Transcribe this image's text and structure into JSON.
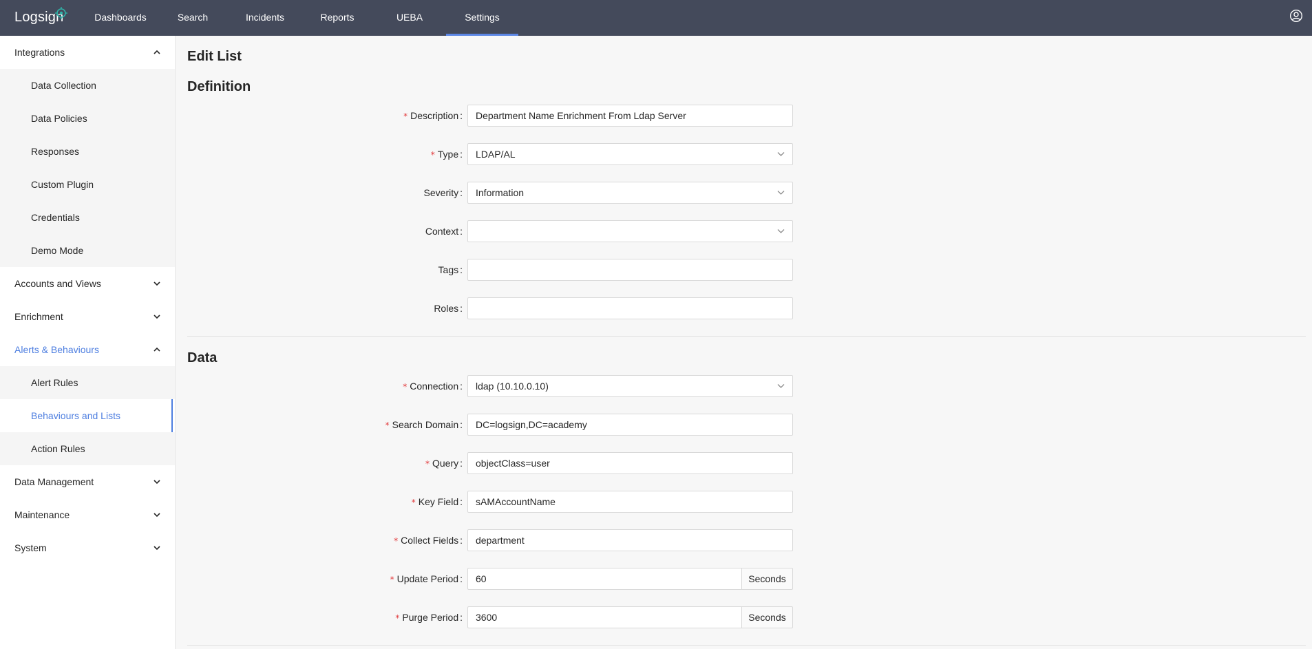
{
  "brand": {
    "logo_text": "Logsign"
  },
  "topnav": {
    "items": [
      {
        "label": "Dashboards"
      },
      {
        "label": "Search"
      },
      {
        "label": "Incidents"
      },
      {
        "label": "Reports"
      },
      {
        "label": "UEBA"
      },
      {
        "label": "Settings",
        "active": true
      }
    ],
    "user_icon": "user-circle-icon"
  },
  "sidebar": {
    "groups": [
      {
        "label": "Integrations",
        "expanded": true,
        "items": [
          {
            "label": "Data Collection"
          },
          {
            "label": "Data Policies"
          },
          {
            "label": "Responses"
          },
          {
            "label": "Custom Plugin"
          },
          {
            "label": "Credentials"
          },
          {
            "label": "Demo Mode"
          }
        ]
      },
      {
        "label": "Accounts and Views",
        "expanded": false
      },
      {
        "label": "Enrichment",
        "expanded": false
      },
      {
        "label": "Alerts & Behaviours",
        "expanded": true,
        "active": true,
        "items": [
          {
            "label": "Alert Rules"
          },
          {
            "label": "Behaviours and Lists",
            "active": true
          },
          {
            "label": "Action Rules"
          }
        ]
      },
      {
        "label": "Data Management",
        "expanded": false
      },
      {
        "label": "Maintenance",
        "expanded": false
      },
      {
        "label": "System",
        "expanded": false
      }
    ]
  },
  "page": {
    "title": "Edit List",
    "definition": {
      "title": "Definition",
      "fields": {
        "description": {
          "label": "Description",
          "required": true,
          "value": "Department  Name Enrichment From Ldap Server"
        },
        "type": {
          "label": "Type",
          "required": true,
          "value": "LDAP/AL"
        },
        "severity": {
          "label": "Severity",
          "required": false,
          "value": "Information"
        },
        "context": {
          "label": "Context",
          "required": false,
          "value": ""
        },
        "tags": {
          "label": "Tags",
          "required": false,
          "value": ""
        },
        "roles": {
          "label": "Roles",
          "required": false,
          "value": ""
        }
      }
    },
    "data": {
      "title": "Data",
      "fields": {
        "connection": {
          "label": "Connection",
          "required": true,
          "value": "ldap (10.10.0.10)"
        },
        "search_domain": {
          "label": "Search Domain",
          "required": true,
          "value": "DC=logsign,DC=academy"
        },
        "query": {
          "label": "Query",
          "required": true,
          "value": "objectClass=user"
        },
        "key_field": {
          "label": "Key Field",
          "required": true,
          "value": "sAMAccountName"
        },
        "collect_fields": {
          "label": "Collect Fields",
          "required": true,
          "value": "department"
        },
        "update_period": {
          "label": "Update Period",
          "required": true,
          "value": "60",
          "unit": "Seconds"
        },
        "purge_period": {
          "label": "Purge Period",
          "required": true,
          "value": "3600",
          "unit": "Seconds"
        }
      }
    }
  },
  "colors": {
    "topbar": "#444a5b",
    "accent": "#4d7ee0",
    "required": "#e2393b"
  },
  "form": {
    "required_mark": "*",
    "colon": ":"
  }
}
